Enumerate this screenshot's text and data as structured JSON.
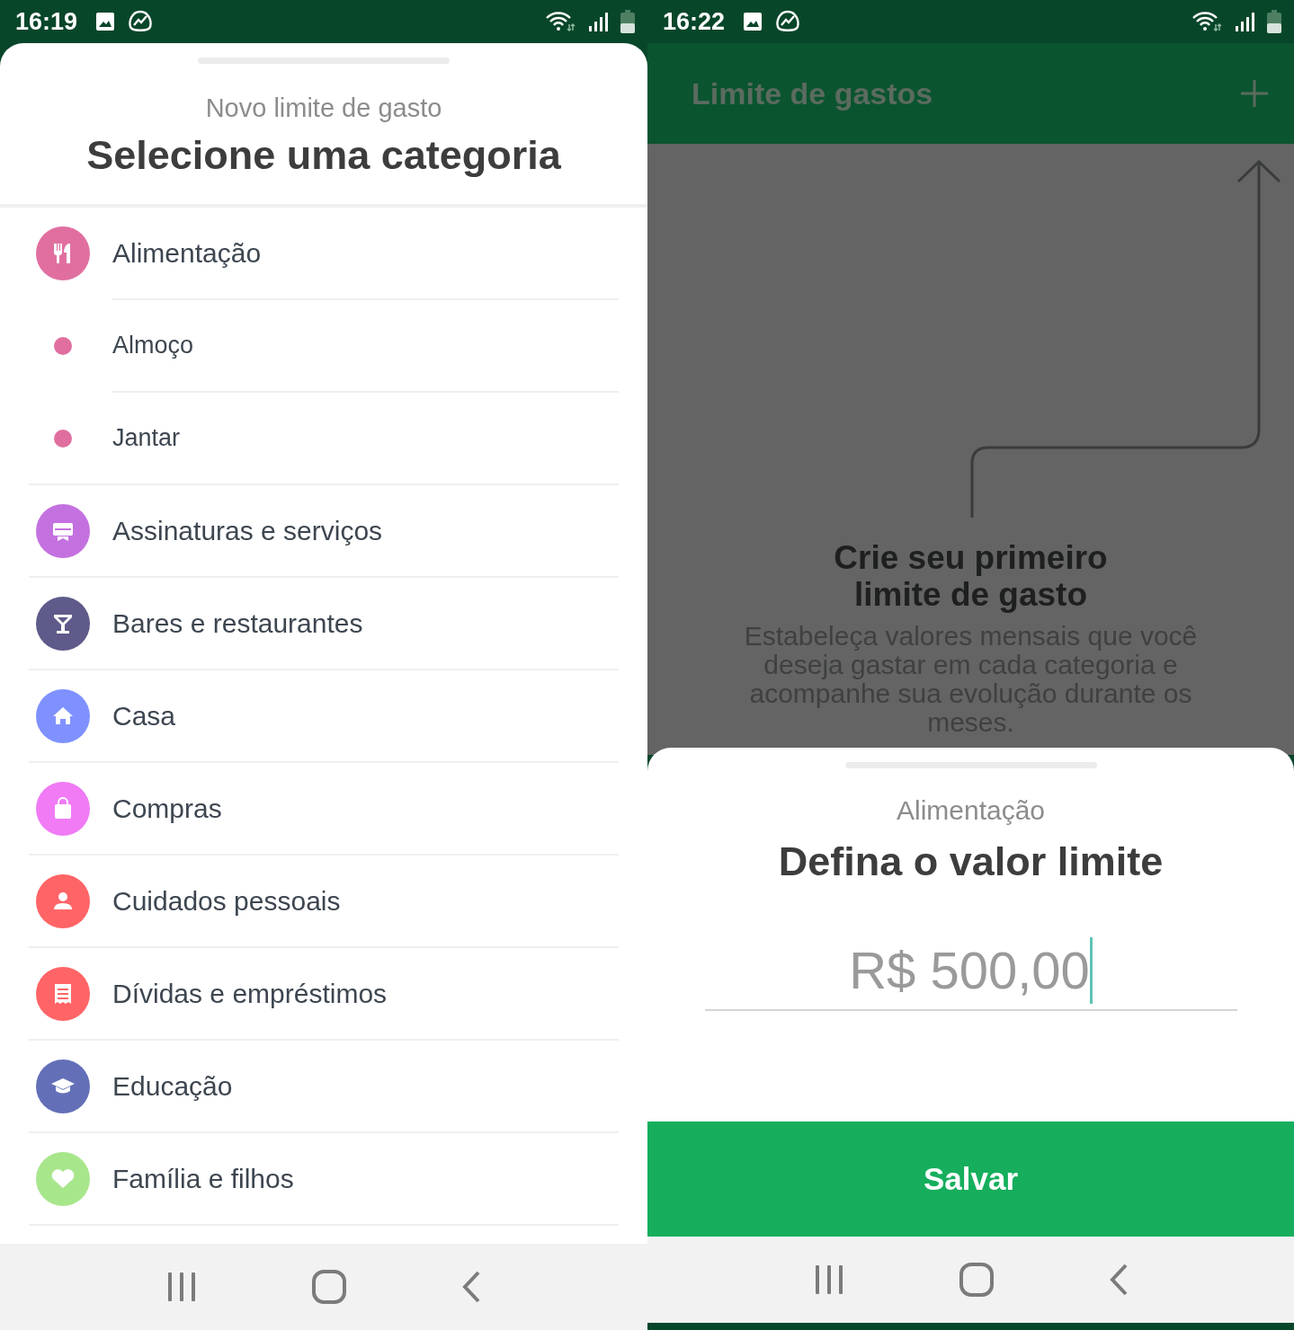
{
  "left_screen": {
    "status_bar": {
      "time": "16:19"
    },
    "sheet": {
      "subtitle": "Novo limite de gasto",
      "title": "Selecione uma categoria",
      "categories": [
        {
          "label": "Alimentação",
          "color": "#e06fa0",
          "children": [
            {
              "label": "Almoço",
              "color": "#e06fa0"
            },
            {
              "label": "Jantar",
              "color": "#e06fa0"
            }
          ]
        },
        {
          "label": "Assinaturas e serviços",
          "color": "#c471e0"
        },
        {
          "label": "Bares e restaurantes",
          "color": "#5e5a8a"
        },
        {
          "label": "Casa",
          "color": "#7f91ff"
        },
        {
          "label": "Compras",
          "color": "#f07bf5"
        },
        {
          "label": "Cuidados pessoais",
          "color": "#ff6466"
        },
        {
          "label": "Dívidas e empréstimos",
          "color": "#ff6466"
        },
        {
          "label": "Educação",
          "color": "#6370b8"
        },
        {
          "label": "Família e filhos",
          "color": "#a8e68c"
        }
      ]
    }
  },
  "right_screen": {
    "status_bar": {
      "time": "16:22"
    },
    "header": {
      "title": "Limite de gastos"
    },
    "empty_state": {
      "title": "Crie seu primeiro limite de gasto",
      "text": "Estabeleça valores mensais que você deseja gastar em cada categoria e acompanhe sua evolução durante os meses."
    },
    "sheet": {
      "subtitle": "Alimentação",
      "title": "Defina o valor limite",
      "amount": "R$ 500,00",
      "save_button": "Salvar"
    }
  }
}
